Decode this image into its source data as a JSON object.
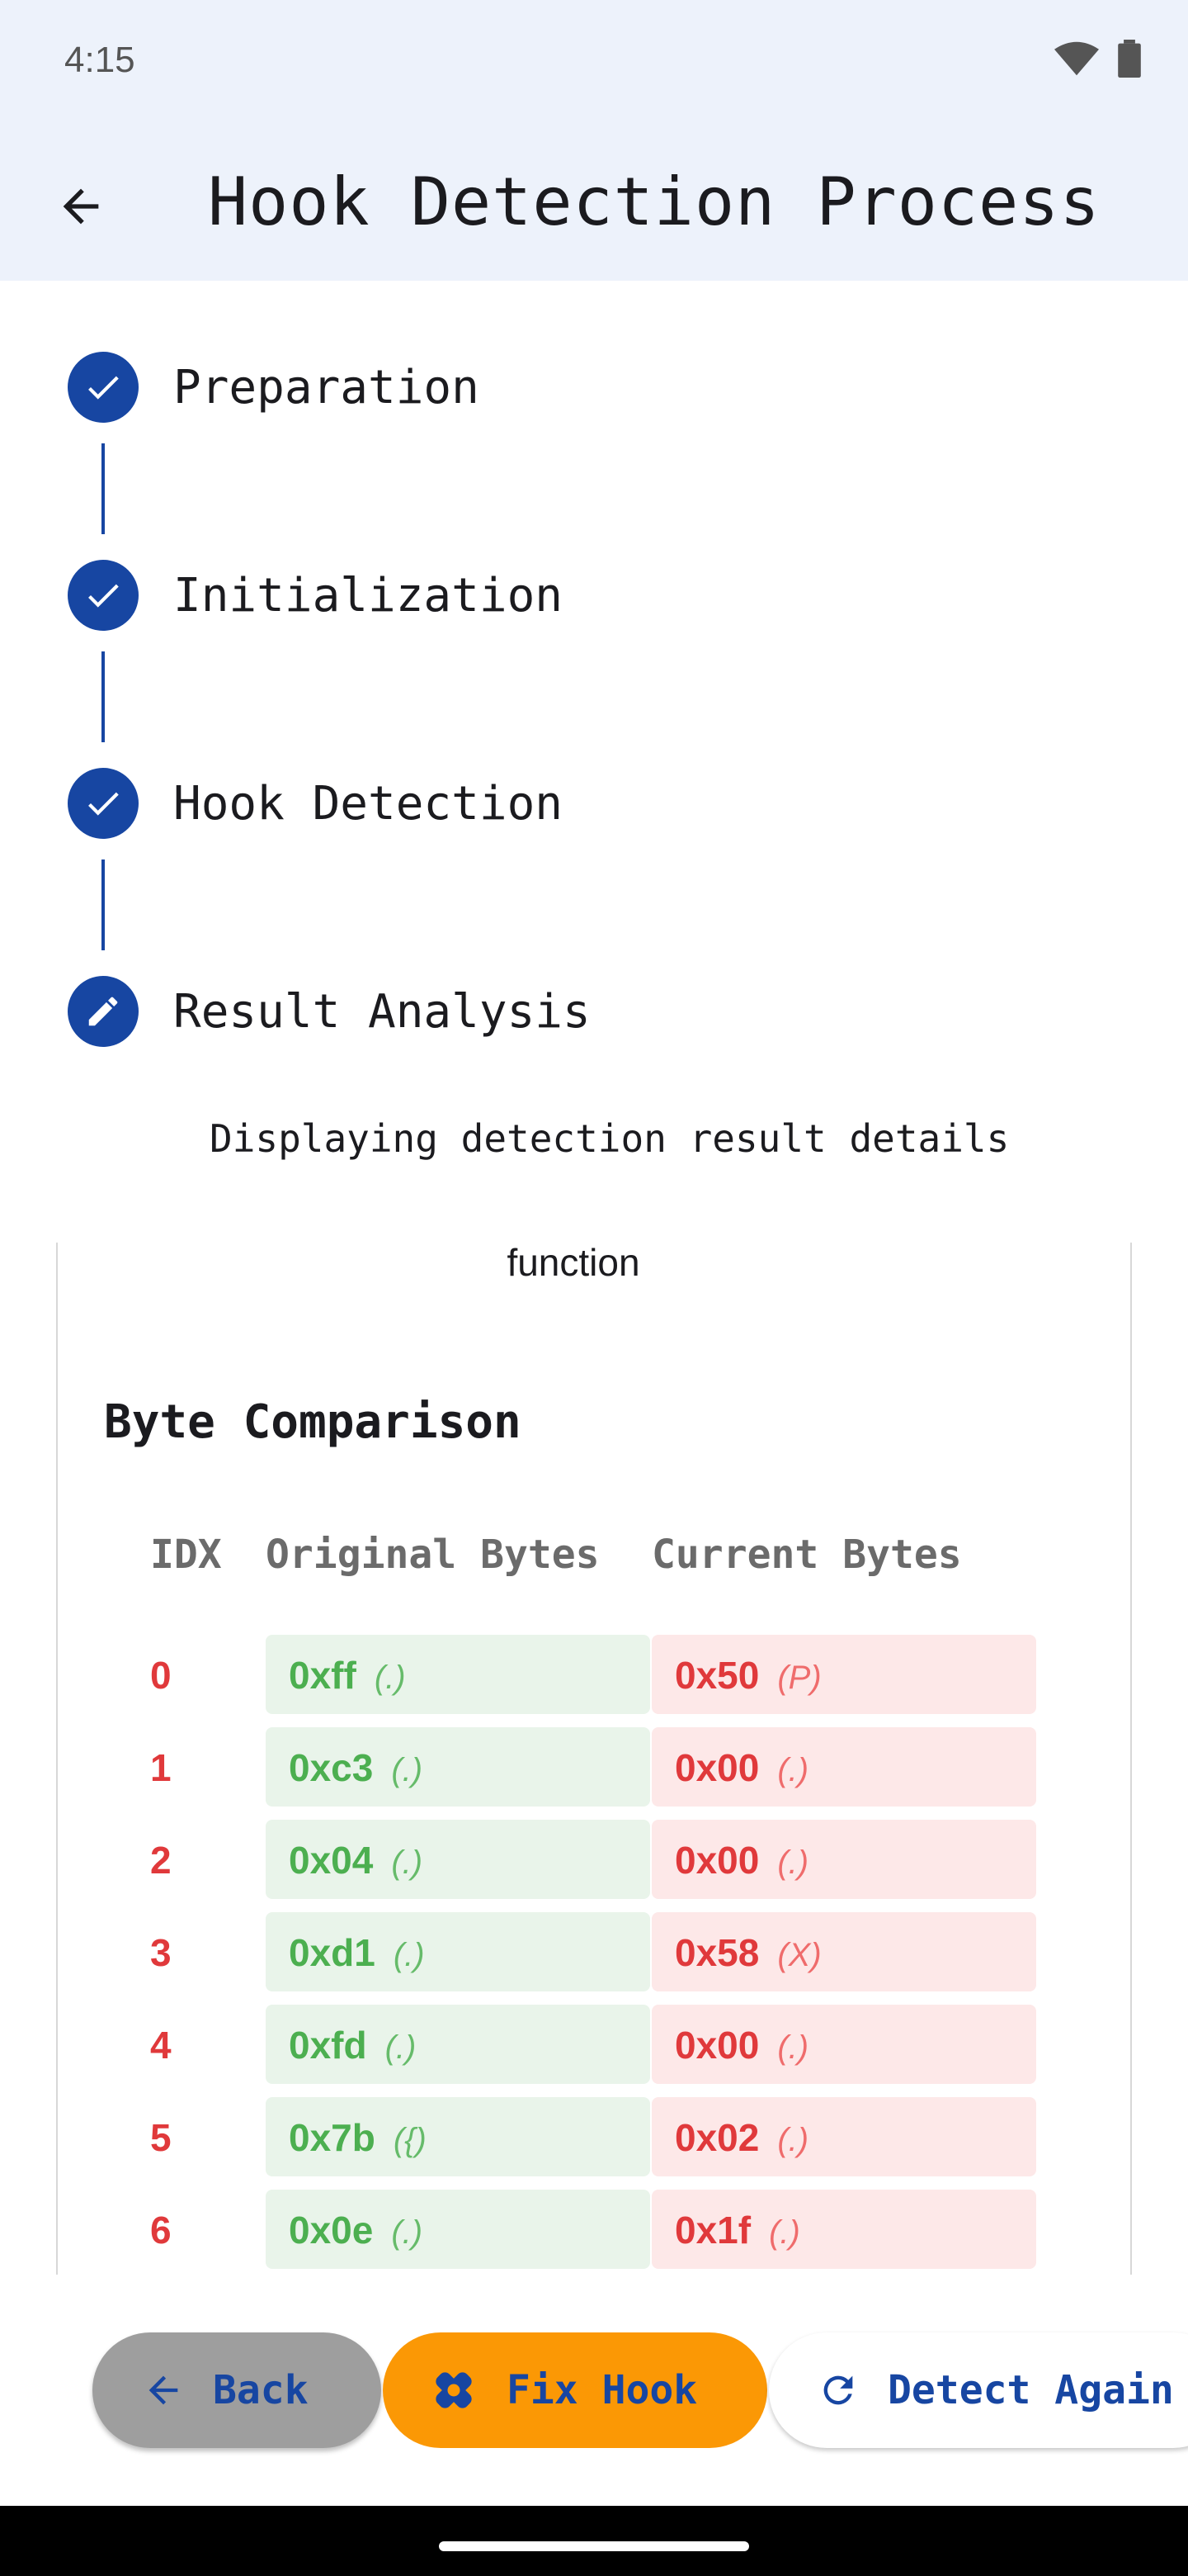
{
  "status_bar": {
    "time": "4:15"
  },
  "app_bar": {
    "title": "Hook Detection Process"
  },
  "steps": [
    {
      "label": "Preparation",
      "state": "done"
    },
    {
      "label": "Initialization",
      "state": "done"
    },
    {
      "label": "Hook Detection",
      "state": "done"
    },
    {
      "label": "Result Analysis",
      "state": "editing"
    }
  ],
  "step_subtitle": "Displaying detection result details",
  "card": {
    "function_text": "function",
    "section_title": "Byte Comparison",
    "columns": {
      "idx": "IDX",
      "original": "Original Bytes",
      "current": "Current Bytes"
    },
    "rows": [
      {
        "idx": "0",
        "orig_hex": "0xff",
        "orig_chr": "(.)",
        "cur_hex": "0x50",
        "cur_chr": "(P)"
      },
      {
        "idx": "1",
        "orig_hex": "0xc3",
        "orig_chr": "(.)",
        "cur_hex": "0x00",
        "cur_chr": "(.)"
      },
      {
        "idx": "2",
        "orig_hex": "0x04",
        "orig_chr": "(.)",
        "cur_hex": "0x00",
        "cur_chr": "(.)"
      },
      {
        "idx": "3",
        "orig_hex": "0xd1",
        "orig_chr": "(.)",
        "cur_hex": "0x58",
        "cur_chr": "(X)"
      },
      {
        "idx": "4",
        "orig_hex": "0xfd",
        "orig_chr": "(.)",
        "cur_hex": "0x00",
        "cur_chr": "(.)"
      },
      {
        "idx": "5",
        "orig_hex": "0x7b",
        "orig_chr": "({)",
        "cur_hex": "0x02",
        "cur_chr": "(.)"
      },
      {
        "idx": "6",
        "orig_hex": "0x0e",
        "orig_chr": "(.)",
        "cur_hex": "0x1f",
        "cur_chr": "(.)"
      }
    ]
  },
  "buttons": {
    "back": "Back",
    "fix": "Fix Hook",
    "detect": "Detect Again"
  },
  "colors": {
    "primary": "#1746a2",
    "accent_orange": "#fb9805",
    "original_bg": "#e9f4ea",
    "current_bg": "#fde8e8",
    "original_text": "#4caf50",
    "current_text": "#e0393b",
    "app_bar_bg": "#edf2fb"
  },
  "icons": {
    "back": "arrow-left-icon",
    "step_done": "check-icon",
    "step_active": "pencil-icon",
    "fix": "bandage-icon",
    "detect": "refresh-icon"
  }
}
